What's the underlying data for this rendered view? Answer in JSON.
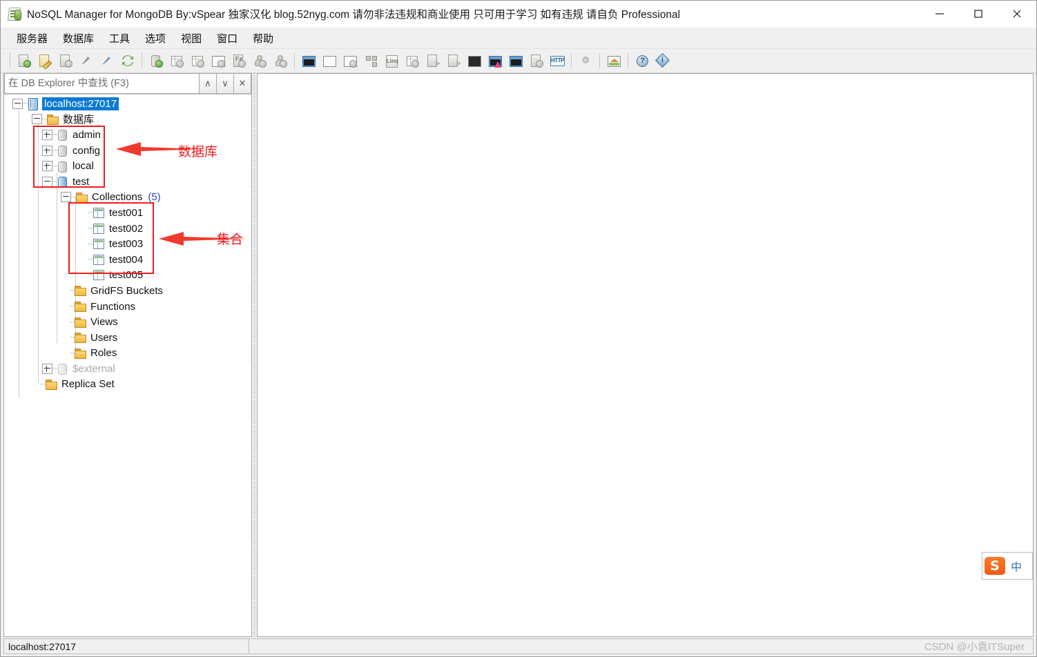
{
  "window": {
    "title": "NoSQL Manager for MongoDB By:vSpear 独家汉化 blog.52nyg.com 请勿非法违规和商业使用 只可用于学习 如有违规 请自负 Professional",
    "app_icon": "mongodb-document-icon",
    "controls": [
      {
        "name": "minimize-button",
        "glyph": "—"
      },
      {
        "name": "maximize-button",
        "glyph": "□"
      },
      {
        "name": "close-button",
        "glyph": "✕"
      }
    ]
  },
  "menubar": {
    "items": [
      {
        "label": "服务器",
        "name": "menu-server"
      },
      {
        "label": "数据库",
        "name": "menu-database"
      },
      {
        "label": "工具",
        "name": "menu-tools"
      },
      {
        "label": "选项",
        "name": "menu-options"
      },
      {
        "label": "视图",
        "name": "menu-view"
      },
      {
        "label": "窗口",
        "name": "menu-window"
      },
      {
        "label": "帮助",
        "name": "menu-help"
      }
    ]
  },
  "toolbar": {
    "groups": [
      [
        {
          "name": "new-connection-icon",
          "kind": "doc-plus"
        },
        {
          "name": "edit-connection-icon",
          "kind": "doc-pencil"
        },
        {
          "name": "delete-connection-icon",
          "kind": "doc-minus"
        },
        {
          "name": "disconnect-icon",
          "kind": "plug-grey"
        },
        {
          "name": "connect-icon",
          "kind": "plug-blue"
        },
        {
          "name": "refresh-icon",
          "kind": "refresh"
        }
      ],
      [
        {
          "name": "new-database-icon",
          "kind": "cyl-plus"
        },
        {
          "name": "new-collection-icon",
          "kind": "grid-plus"
        },
        {
          "name": "new-view-icon",
          "kind": "grid2-plus"
        },
        {
          "name": "new-gridfs-icon",
          "kind": "win-plus"
        },
        {
          "name": "new-function-icon",
          "kind": "fx-plus"
        },
        {
          "name": "new-user-icon",
          "kind": "user-plus"
        },
        {
          "name": "new-role-icon",
          "kind": "users-plus"
        }
      ],
      [
        {
          "name": "shell-window-icon",
          "kind": "console"
        },
        {
          "name": "blank-window-icon",
          "kind": "window"
        },
        {
          "name": "settings-window-icon",
          "kind": "window-gear"
        },
        {
          "name": "tree-view-icon",
          "kind": "tree"
        },
        {
          "name": "linq-query-icon",
          "kind": "linq"
        },
        {
          "name": "table-view-icon",
          "kind": "table"
        },
        {
          "name": "export-icon",
          "kind": "export"
        },
        {
          "name": "import-icon",
          "kind": "import"
        },
        {
          "name": "script-icon",
          "kind": "script"
        },
        {
          "name": "run-script-icon",
          "kind": "run-script"
        },
        {
          "name": "query-builder-icon",
          "kind": "query-builder"
        },
        {
          "name": "copy-icon",
          "kind": "copy"
        },
        {
          "name": "http-icon",
          "kind": "http"
        }
      ],
      [
        {
          "name": "options-gear-icon",
          "kind": "gear"
        }
      ],
      [
        {
          "name": "home-icon",
          "kind": "home"
        }
      ],
      [
        {
          "name": "help-icon",
          "kind": "help"
        },
        {
          "name": "about-icon",
          "kind": "about"
        }
      ]
    ]
  },
  "explorer": {
    "search": {
      "placeholder": "在 DB Explorer 中查找 (F3)",
      "value": "",
      "prev_label": "∧",
      "next_label": "∨",
      "close_label": "✕"
    },
    "tree": {
      "root": {
        "label": "localhost:27017",
        "icon": "server-icon",
        "expanded": true,
        "selected": true
      },
      "databases_folder": {
        "label": "数据库",
        "icon": "folder-icon",
        "expanded": true
      },
      "databases": [
        {
          "label": "admin",
          "icon": "database-icon",
          "expanded": false
        },
        {
          "label": "config",
          "icon": "database-icon",
          "expanded": false
        },
        {
          "label": "local",
          "icon": "database-icon",
          "expanded": false
        },
        {
          "label": "test",
          "icon": "database-icon-active",
          "expanded": true
        }
      ],
      "collections_folder": {
        "label": "Collections",
        "count": "(5)",
        "icon": "folder-icon",
        "expanded": true
      },
      "collections": [
        {
          "label": "test001",
          "icon": "collection-icon"
        },
        {
          "label": "test002",
          "icon": "collection-icon"
        },
        {
          "label": "test003",
          "icon": "collection-icon"
        },
        {
          "label": "test004",
          "icon": "collection-icon"
        },
        {
          "label": "test005",
          "icon": "collection-icon"
        }
      ],
      "test_children": [
        {
          "label": "GridFS Buckets",
          "icon": "folder-icon"
        },
        {
          "label": "Functions",
          "icon": "folder-icon"
        },
        {
          "label": "Views",
          "icon": "folder-icon"
        },
        {
          "label": "Users",
          "icon": "folder-icon"
        },
        {
          "label": "Roles",
          "icon": "folder-icon"
        }
      ],
      "external": {
        "label": "$external",
        "icon": "database-icon-disabled",
        "expanded": false
      },
      "replica_set": {
        "label": "Replica Set",
        "icon": "folder-icon"
      }
    }
  },
  "annotations": {
    "color": "#ee1c1c",
    "databases_label": "数据库",
    "collections_label": "集合"
  },
  "ime": {
    "logo_text": "S",
    "mode_text": "中"
  },
  "statusbar": {
    "connection": "localhost:27017",
    "watermark": "CSDN @小袁ITSuper"
  }
}
